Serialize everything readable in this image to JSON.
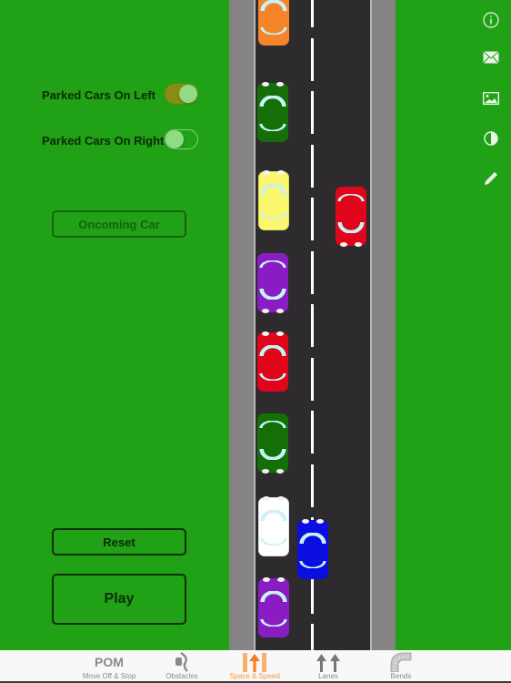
{
  "settings": {
    "toggles": [
      {
        "label": "Parked Cars On Left",
        "on": true
      },
      {
        "label": "Parked Cars On Right",
        "on": false
      }
    ],
    "oncoming_button": {
      "label": "Oncoming Car",
      "enabled": false
    },
    "reset_button": {
      "label": "Reset"
    },
    "play_button": {
      "label": "Play"
    }
  },
  "side_icons": [
    "info-icon",
    "mail-icon",
    "image-icon",
    "contrast-icon",
    "pencil-icon"
  ],
  "road": {
    "cars": [
      {
        "name": "parked-car-orange",
        "color": "#f5842a",
        "direction": "up",
        "lane": "left-parked"
      },
      {
        "name": "parked-car-green",
        "color": "#146f06",
        "direction": "up",
        "lane": "left-parked"
      },
      {
        "name": "parked-car-yellow",
        "color": "#fbf76e",
        "direction": "up",
        "lane": "left-parked"
      },
      {
        "name": "oncoming-car-red",
        "color": "#e0051a",
        "direction": "down",
        "lane": "right"
      },
      {
        "name": "parked-car-purple",
        "color": "#8a1cc4",
        "direction": "down",
        "lane": "left-parked"
      },
      {
        "name": "parked-car-red",
        "color": "#e0051a",
        "direction": "up",
        "lane": "left-parked"
      },
      {
        "name": "parked-car-green-2",
        "color": "#146f06",
        "direction": "down",
        "lane": "left-parked"
      },
      {
        "name": "parked-car-white",
        "color": "#ffffff",
        "direction": "up",
        "lane": "left-parked"
      },
      {
        "name": "player-car-blue",
        "color": "#0b0ee0",
        "direction": "up",
        "lane": "left"
      },
      {
        "name": "parked-car-purple-2",
        "color": "#8a1cc4",
        "direction": "up",
        "lane": "left-parked"
      }
    ]
  },
  "tabbar": {
    "tabs": [
      {
        "icon_text": "POM",
        "label": "Move Off & Stop",
        "active": false
      },
      {
        "label": "Obstacles",
        "active": false
      },
      {
        "label": "Space & Speed",
        "active": true
      },
      {
        "label": "Lanes",
        "active": false
      },
      {
        "label": "Bends",
        "active": false
      }
    ]
  },
  "colors": {
    "grass": "#21a116",
    "road": "#2d2b2d",
    "pavement": "#858384",
    "accent": "#f59a3c"
  }
}
